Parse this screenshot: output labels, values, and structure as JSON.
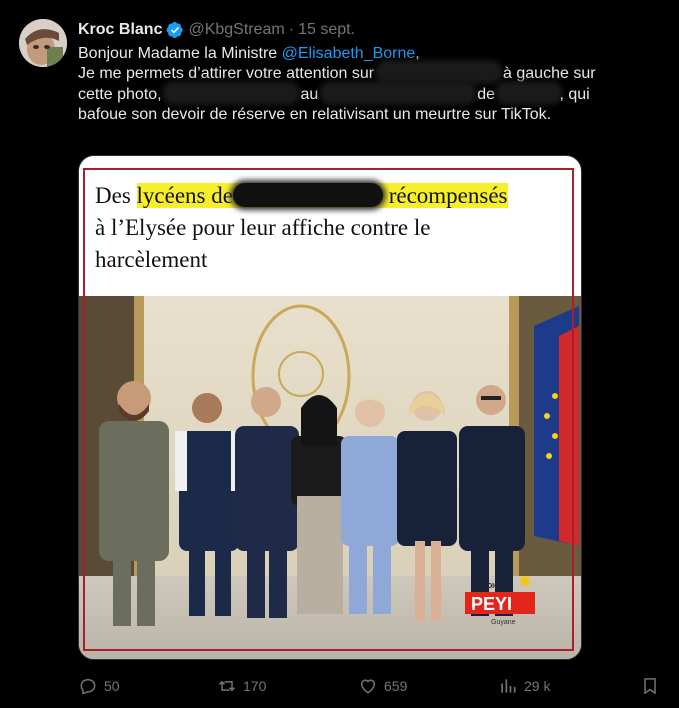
{
  "tweet": {
    "author_name": "Kroc Blanc",
    "handle": "@KbgStream",
    "separator": "·",
    "date": "15 sept.",
    "line1": "Bonjour Madame la Ministre ",
    "mention": "@Elisabeth_Borne",
    "line1_end": ",",
    "line2_a": "Je me permets d’attirer votre attention sur",
    "line2_b": "à gauche sur",
    "line3_a": "cette photo,",
    "line3_b": "au",
    "line3_c": "de",
    "line3_d": ", qui",
    "line4": "bafoue son devoir de réserve en relativisant un meurtre sur TikTok."
  },
  "media": {
    "headline_a": "Des ",
    "headline_hl1": "lycéens de",
    "headline_hl2": "récompensés",
    "headline_b": "à l’Elysée pour leur affiche contre le",
    "headline_c": "harcèlement",
    "logo_top": "RADIO",
    "logo_main": "PEYI",
    "logo_bottom": "Guyane"
  },
  "actions": {
    "replies": "50",
    "retweets": "170",
    "likes": "659",
    "views": "29 k"
  },
  "colors": {
    "accent": "#1d9bf0",
    "muted": "#71767b",
    "highlight": "#f6ef2a",
    "frame": "#a8202a"
  }
}
